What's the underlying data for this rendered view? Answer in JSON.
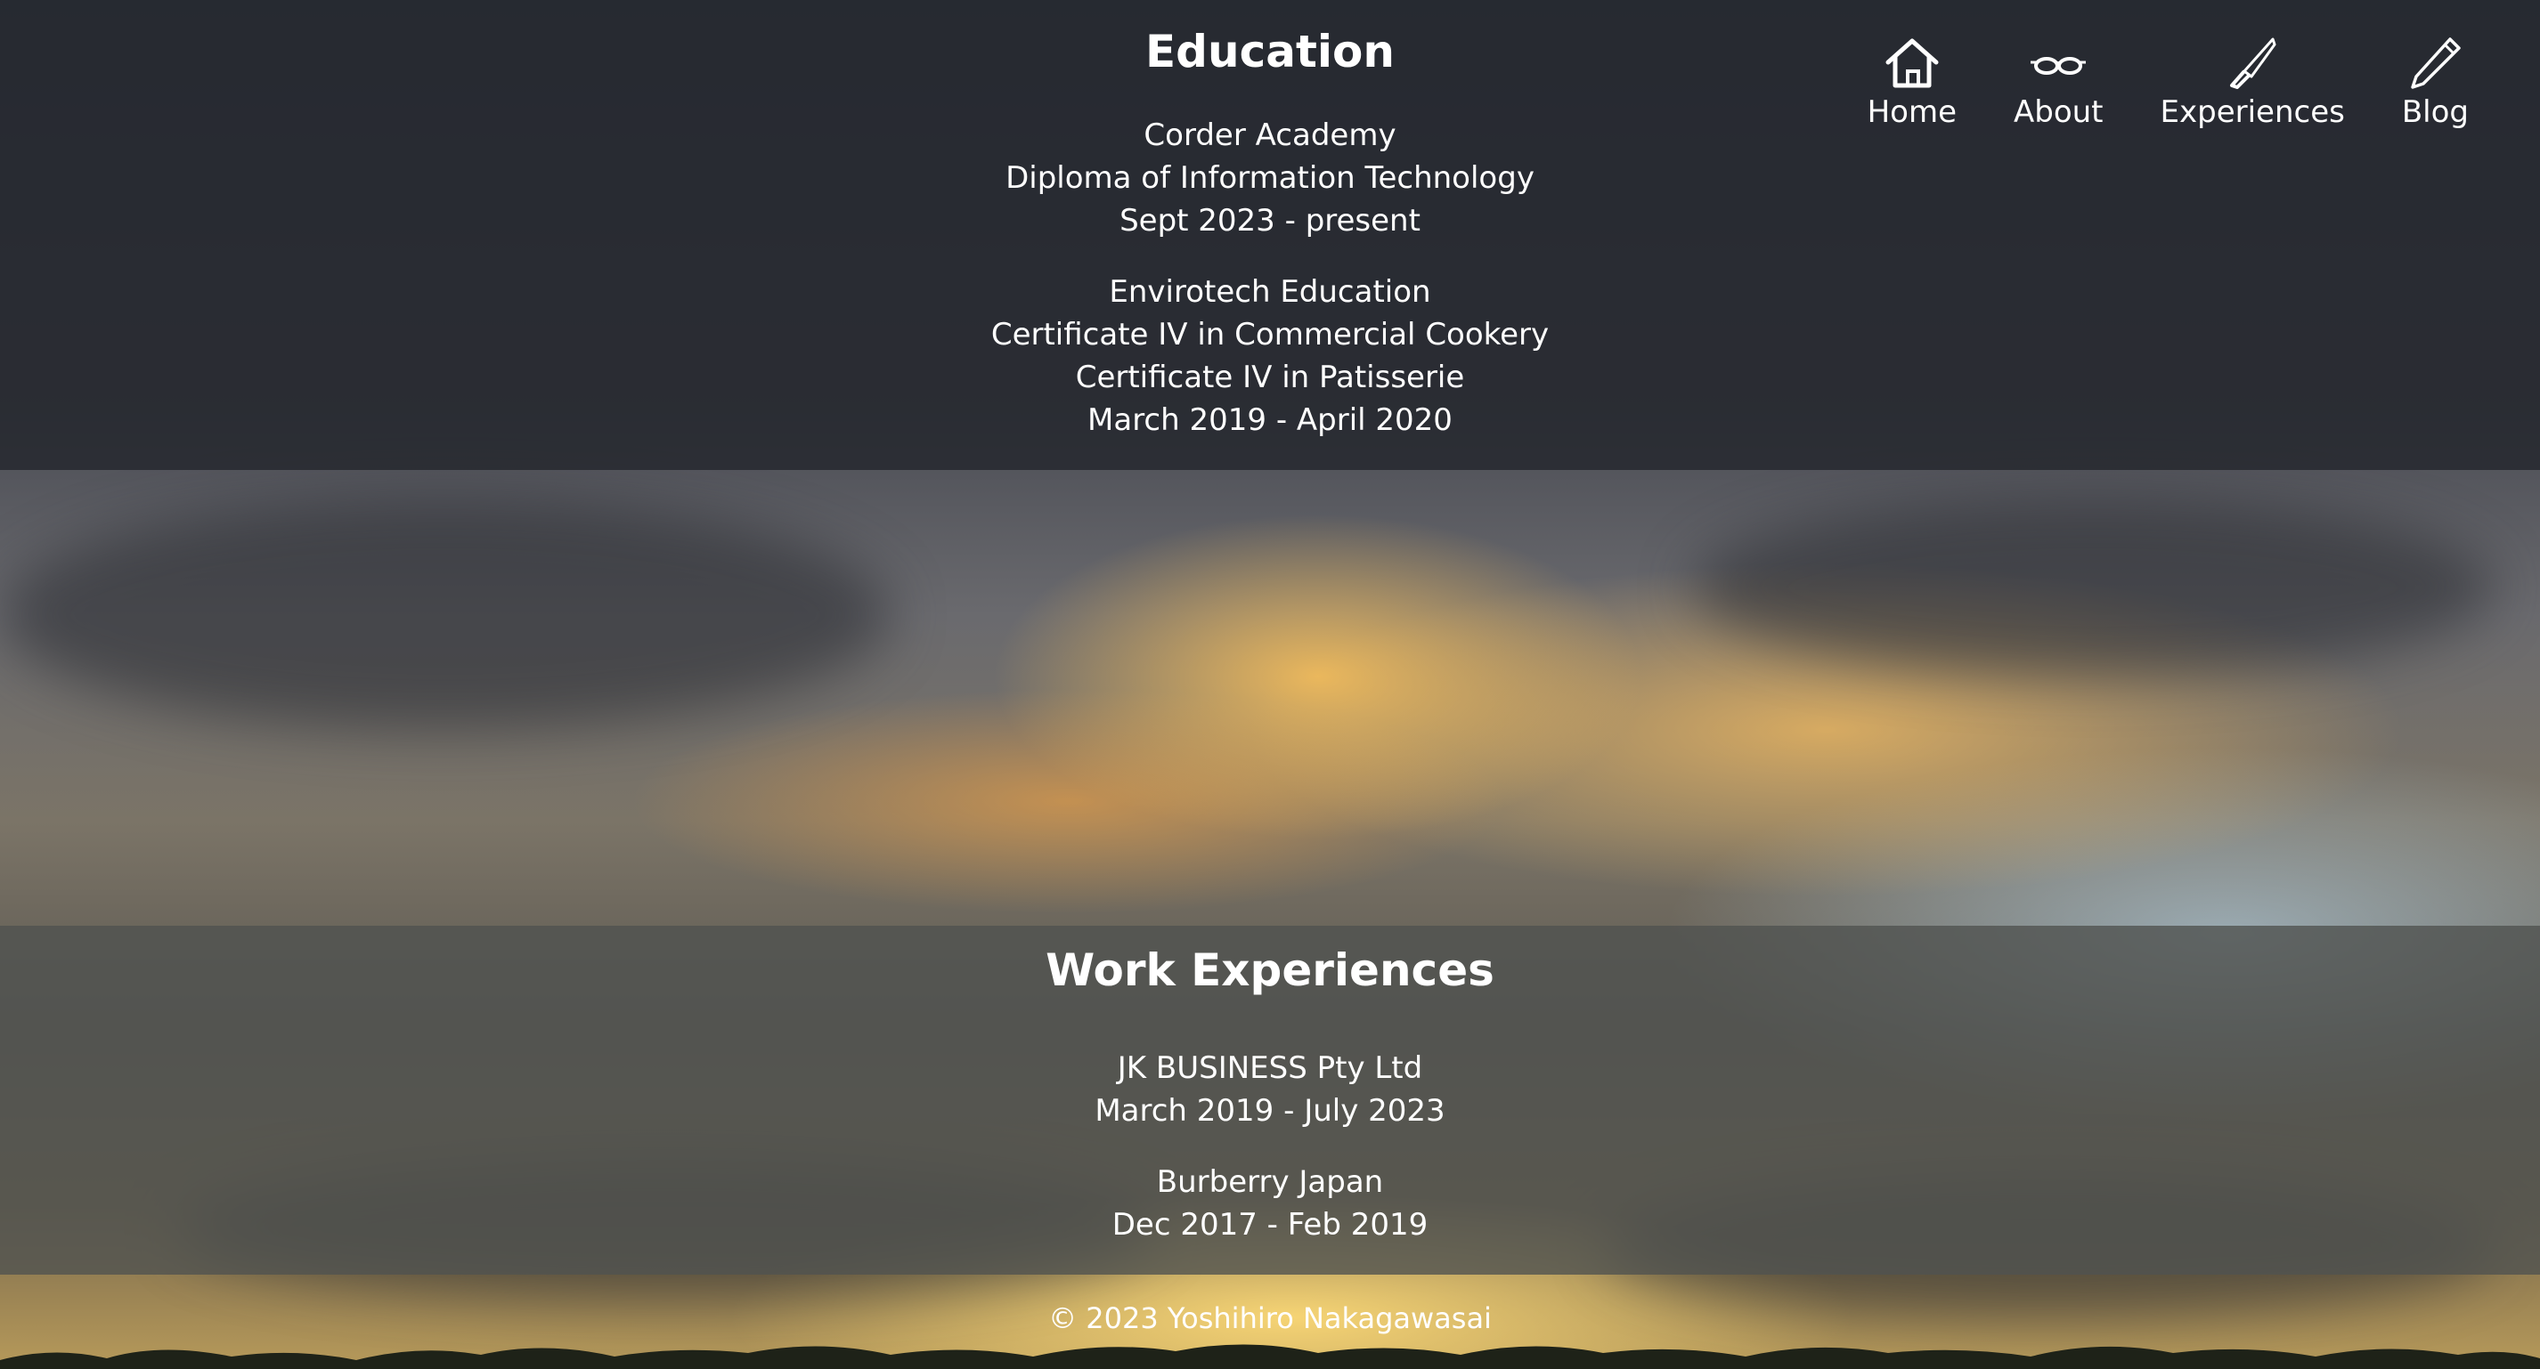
{
  "nav": {
    "items": [
      {
        "label": "Home",
        "icon": "home-icon"
      },
      {
        "label": "About",
        "icon": "glasses-icon"
      },
      {
        "label": "Experiences",
        "icon": "knife-icon"
      },
      {
        "label": "Blog",
        "icon": "pencil-icon"
      }
    ]
  },
  "education": {
    "title": "Education",
    "entries": [
      {
        "lines": [
          "Corder Academy",
          "Diploma of Information Technology",
          "Sept 2023 - present"
        ]
      },
      {
        "lines": [
          "Envirotech Education",
          "Certificate IV in Commercial Cookery",
          "Certificate IV in Patisserie",
          "March 2019 - April 2020"
        ]
      }
    ]
  },
  "work": {
    "title": "Work Experiences",
    "entries": [
      {
        "lines": [
          "JK BUSINESS Pty Ltd",
          "March 2019 - July 2023"
        ]
      },
      {
        "lines": [
          "Burberry Japan",
          "Dec 2017 - Feb 2019"
        ]
      }
    ]
  },
  "footer": {
    "copyright": "© 2023 Yoshihiro Nakagawasai"
  },
  "colors": {
    "text": "#ffffff",
    "education_band": "#21242a",
    "work_band": "#505250",
    "sky_gold": "#f8be5f"
  }
}
